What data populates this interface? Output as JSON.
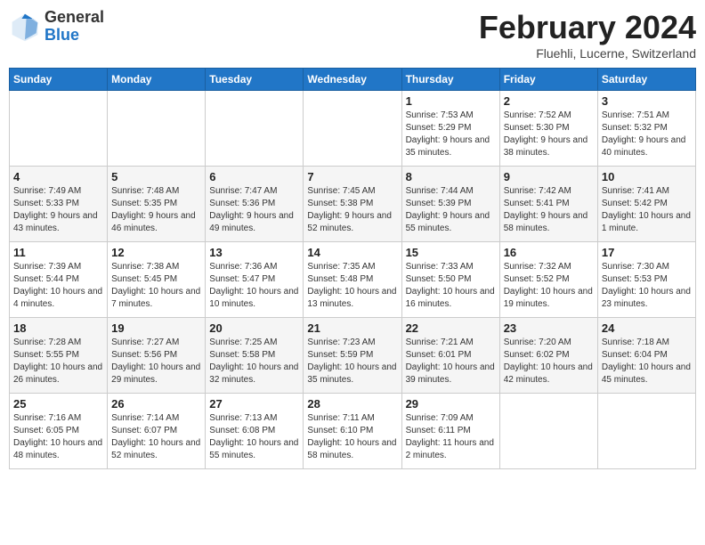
{
  "header": {
    "logo_general": "General",
    "logo_blue": "Blue",
    "month_title": "February 2024",
    "location": "Fluehli, Lucerne, Switzerland"
  },
  "calendar": {
    "days_of_week": [
      "Sunday",
      "Monday",
      "Tuesday",
      "Wednesday",
      "Thursday",
      "Friday",
      "Saturday"
    ],
    "weeks": [
      [
        {
          "day": "",
          "info": ""
        },
        {
          "day": "",
          "info": ""
        },
        {
          "day": "",
          "info": ""
        },
        {
          "day": "",
          "info": ""
        },
        {
          "day": "1",
          "info": "Sunrise: 7:53 AM\nSunset: 5:29 PM\nDaylight: 9 hours and 35 minutes."
        },
        {
          "day": "2",
          "info": "Sunrise: 7:52 AM\nSunset: 5:30 PM\nDaylight: 9 hours and 38 minutes."
        },
        {
          "day": "3",
          "info": "Sunrise: 7:51 AM\nSunset: 5:32 PM\nDaylight: 9 hours and 40 minutes."
        }
      ],
      [
        {
          "day": "4",
          "info": "Sunrise: 7:49 AM\nSunset: 5:33 PM\nDaylight: 9 hours and 43 minutes."
        },
        {
          "day": "5",
          "info": "Sunrise: 7:48 AM\nSunset: 5:35 PM\nDaylight: 9 hours and 46 minutes."
        },
        {
          "day": "6",
          "info": "Sunrise: 7:47 AM\nSunset: 5:36 PM\nDaylight: 9 hours and 49 minutes."
        },
        {
          "day": "7",
          "info": "Sunrise: 7:45 AM\nSunset: 5:38 PM\nDaylight: 9 hours and 52 minutes."
        },
        {
          "day": "8",
          "info": "Sunrise: 7:44 AM\nSunset: 5:39 PM\nDaylight: 9 hours and 55 minutes."
        },
        {
          "day": "9",
          "info": "Sunrise: 7:42 AM\nSunset: 5:41 PM\nDaylight: 9 hours and 58 minutes."
        },
        {
          "day": "10",
          "info": "Sunrise: 7:41 AM\nSunset: 5:42 PM\nDaylight: 10 hours and 1 minute."
        }
      ],
      [
        {
          "day": "11",
          "info": "Sunrise: 7:39 AM\nSunset: 5:44 PM\nDaylight: 10 hours and 4 minutes."
        },
        {
          "day": "12",
          "info": "Sunrise: 7:38 AM\nSunset: 5:45 PM\nDaylight: 10 hours and 7 minutes."
        },
        {
          "day": "13",
          "info": "Sunrise: 7:36 AM\nSunset: 5:47 PM\nDaylight: 10 hours and 10 minutes."
        },
        {
          "day": "14",
          "info": "Sunrise: 7:35 AM\nSunset: 5:48 PM\nDaylight: 10 hours and 13 minutes."
        },
        {
          "day": "15",
          "info": "Sunrise: 7:33 AM\nSunset: 5:50 PM\nDaylight: 10 hours and 16 minutes."
        },
        {
          "day": "16",
          "info": "Sunrise: 7:32 AM\nSunset: 5:52 PM\nDaylight: 10 hours and 19 minutes."
        },
        {
          "day": "17",
          "info": "Sunrise: 7:30 AM\nSunset: 5:53 PM\nDaylight: 10 hours and 23 minutes."
        }
      ],
      [
        {
          "day": "18",
          "info": "Sunrise: 7:28 AM\nSunset: 5:55 PM\nDaylight: 10 hours and 26 minutes."
        },
        {
          "day": "19",
          "info": "Sunrise: 7:27 AM\nSunset: 5:56 PM\nDaylight: 10 hours and 29 minutes."
        },
        {
          "day": "20",
          "info": "Sunrise: 7:25 AM\nSunset: 5:58 PM\nDaylight: 10 hours and 32 minutes."
        },
        {
          "day": "21",
          "info": "Sunrise: 7:23 AM\nSunset: 5:59 PM\nDaylight: 10 hours and 35 minutes."
        },
        {
          "day": "22",
          "info": "Sunrise: 7:21 AM\nSunset: 6:01 PM\nDaylight: 10 hours and 39 minutes."
        },
        {
          "day": "23",
          "info": "Sunrise: 7:20 AM\nSunset: 6:02 PM\nDaylight: 10 hours and 42 minutes."
        },
        {
          "day": "24",
          "info": "Sunrise: 7:18 AM\nSunset: 6:04 PM\nDaylight: 10 hours and 45 minutes."
        }
      ],
      [
        {
          "day": "25",
          "info": "Sunrise: 7:16 AM\nSunset: 6:05 PM\nDaylight: 10 hours and 48 minutes."
        },
        {
          "day": "26",
          "info": "Sunrise: 7:14 AM\nSunset: 6:07 PM\nDaylight: 10 hours and 52 minutes."
        },
        {
          "day": "27",
          "info": "Sunrise: 7:13 AM\nSunset: 6:08 PM\nDaylight: 10 hours and 55 minutes."
        },
        {
          "day": "28",
          "info": "Sunrise: 7:11 AM\nSunset: 6:10 PM\nDaylight: 10 hours and 58 minutes."
        },
        {
          "day": "29",
          "info": "Sunrise: 7:09 AM\nSunset: 6:11 PM\nDaylight: 11 hours and 2 minutes."
        },
        {
          "day": "",
          "info": ""
        },
        {
          "day": "",
          "info": ""
        }
      ]
    ]
  }
}
